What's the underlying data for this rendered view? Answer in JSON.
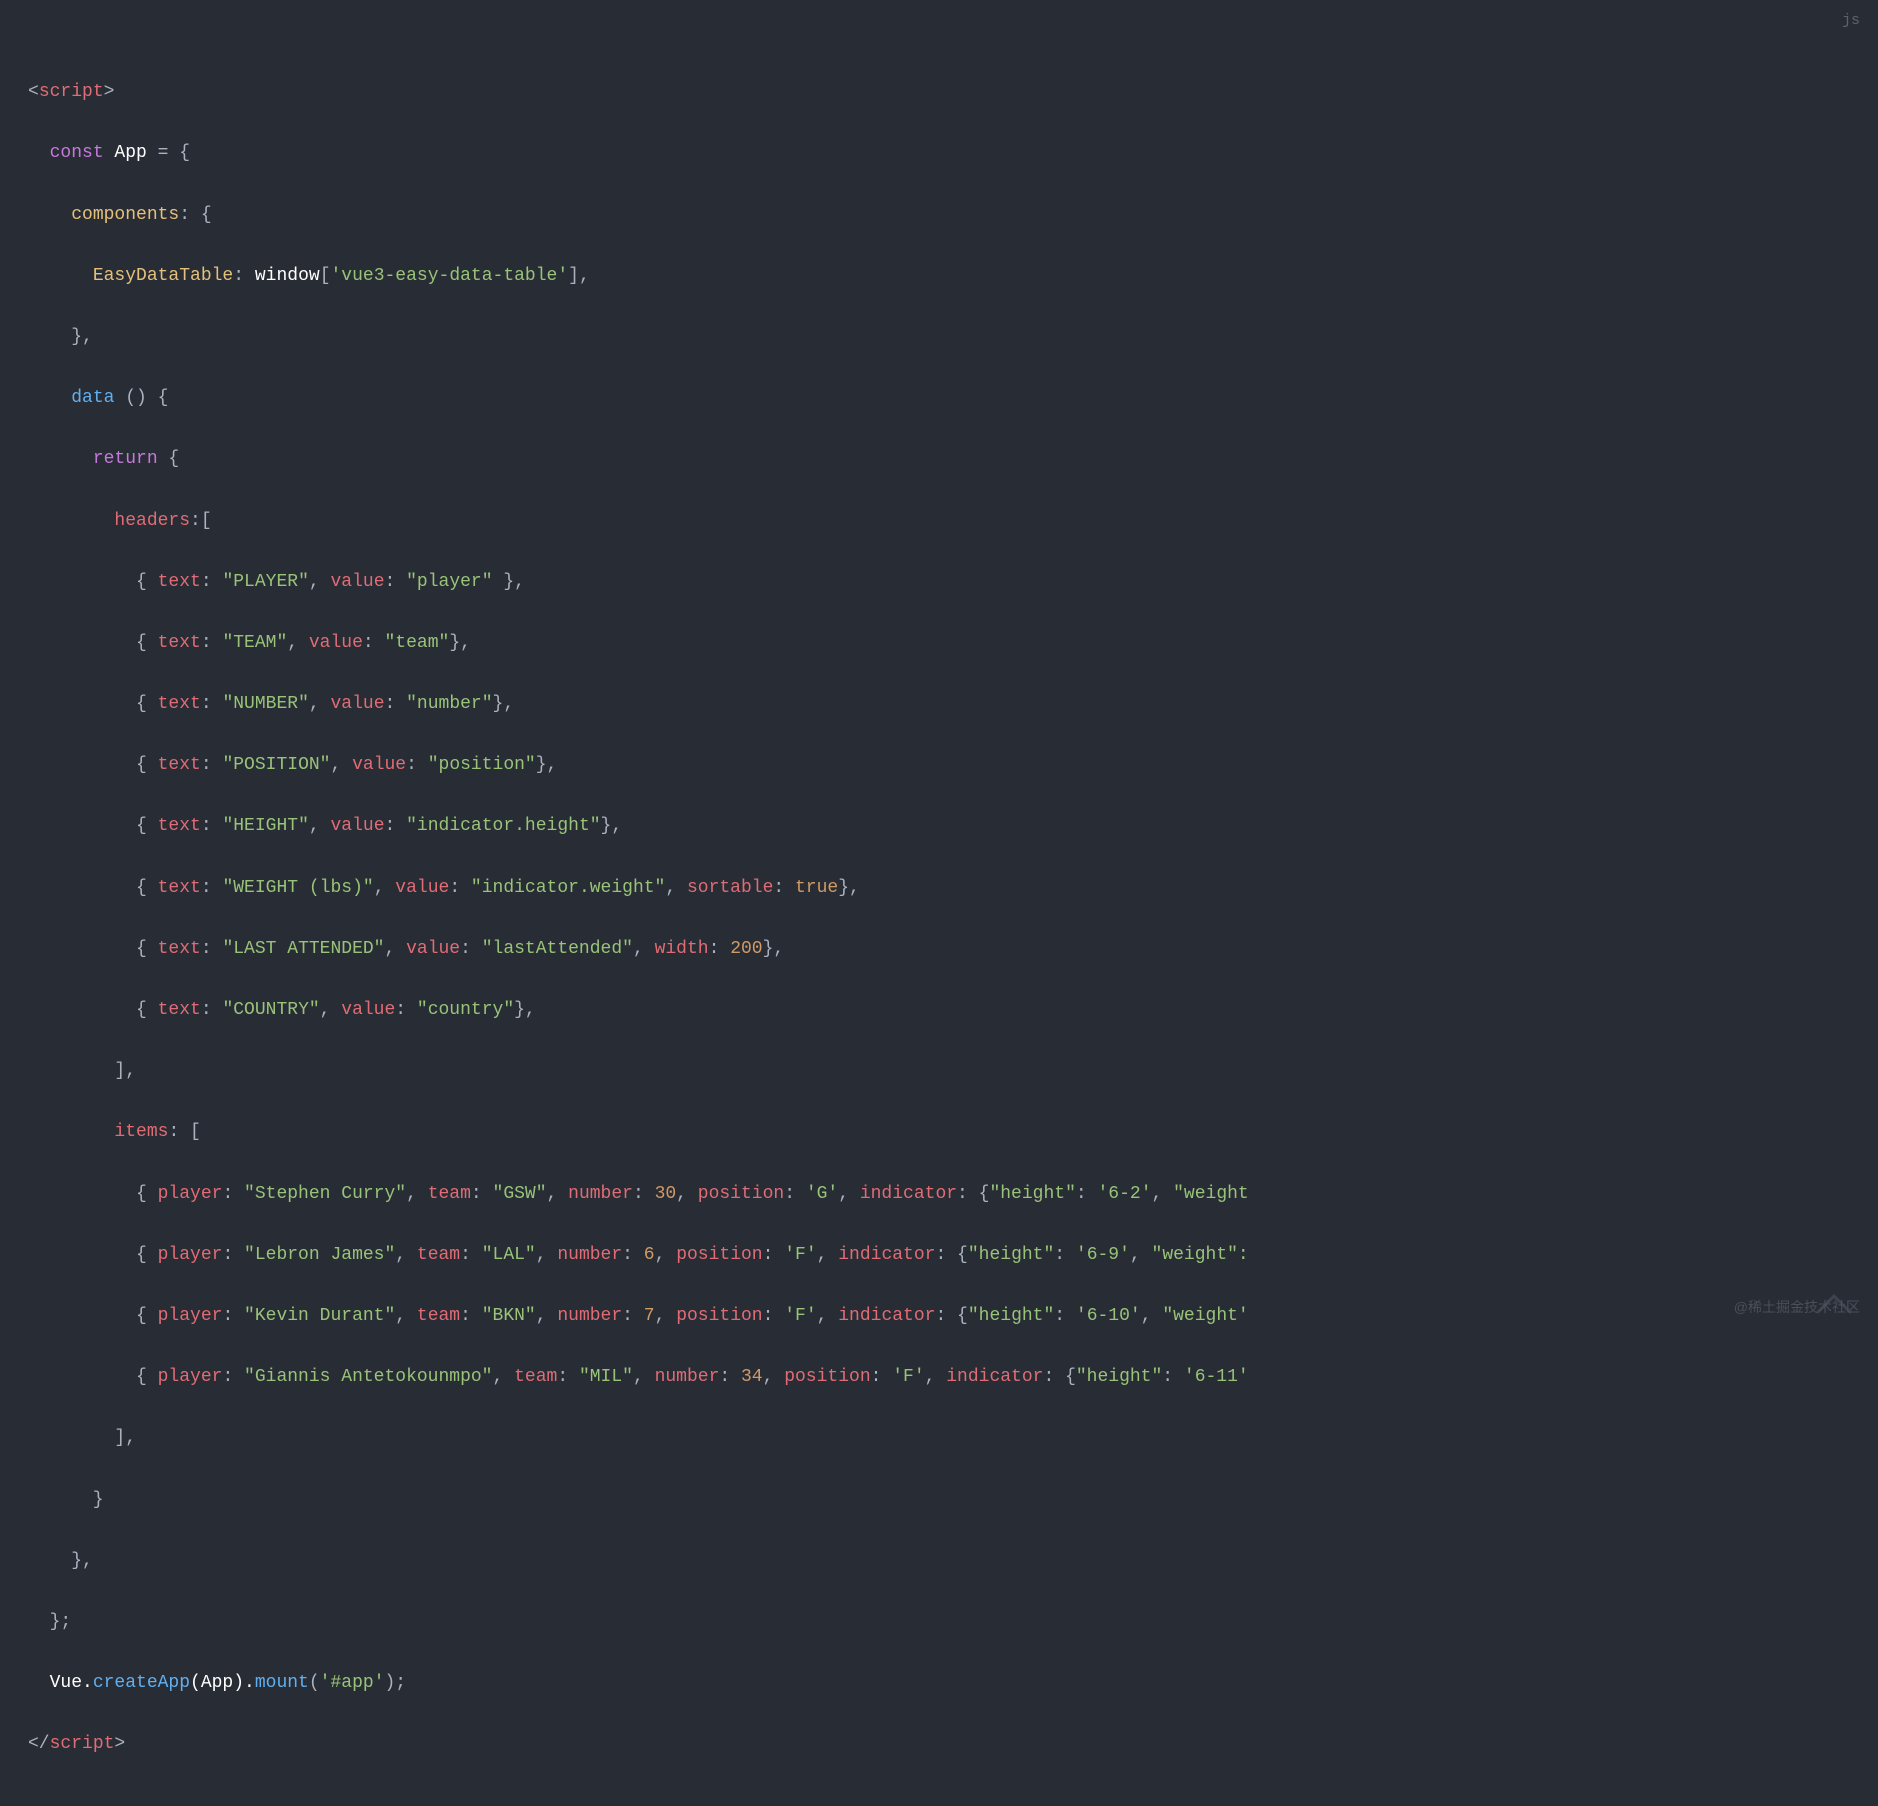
{
  "lang_label": "js",
  "watermark": "@稀土掘金技术社区",
  "code": {
    "l1": {
      "a": "<",
      "b": "script",
      "c": ">"
    },
    "l2": {
      "a": "  ",
      "b": "const",
      "c": " App ",
      "d": "=",
      "e": " {"
    },
    "l3": {
      "a": "    ",
      "b": "components",
      "c": ":",
      "d": " {"
    },
    "l4": {
      "a": "      ",
      "b": "EasyDataTable",
      "c": ":",
      "d": " window",
      "e": "[",
      "f": "'vue3-easy-data-table'",
      "g": "],"
    },
    "l5": {
      "a": "    },"
    },
    "l6": {
      "a": "    ",
      "b": "data",
      "c": " () {"
    },
    "l7": {
      "a": "      ",
      "b": "return",
      "c": " {"
    },
    "l8": {
      "a": "        ",
      "b": "headers",
      "c": ":["
    },
    "l9": {
      "a": "          { ",
      "b": "text",
      "c": ": ",
      "d": "\"PLAYER\"",
      "e": ", ",
      "f": "value",
      "g": ": ",
      "h": "\"player\"",
      "i": " },"
    },
    "l10": {
      "a": "          { ",
      "b": "text",
      "c": ": ",
      "d": "\"TEAM\"",
      "e": ", ",
      "f": "value",
      "g": ": ",
      "h": "\"team\"",
      "i": "},"
    },
    "l11": {
      "a": "          { ",
      "b": "text",
      "c": ": ",
      "d": "\"NUMBER\"",
      "e": ", ",
      "f": "value",
      "g": ": ",
      "h": "\"number\"",
      "i": "},"
    },
    "l12": {
      "a": "          { ",
      "b": "text",
      "c": ": ",
      "d": "\"POSITION\"",
      "e": ", ",
      "f": "value",
      "g": ": ",
      "h": "\"position\"",
      "i": "},"
    },
    "l13": {
      "a": "          { ",
      "b": "text",
      "c": ": ",
      "d": "\"HEIGHT\"",
      "e": ", ",
      "f": "value",
      "g": ": ",
      "h": "\"indicator.height\"",
      "i": "},"
    },
    "l14": {
      "a": "          { ",
      "b": "text",
      "c": ": ",
      "d": "\"WEIGHT (lbs)\"",
      "e": ", ",
      "f": "value",
      "g": ": ",
      "h": "\"indicator.weight\"",
      "i": ", ",
      "j": "sortable",
      "k": ": ",
      "l": "true",
      "m": "},"
    },
    "l15": {
      "a": "          { ",
      "b": "text",
      "c": ": ",
      "d": "\"LAST ATTENDED\"",
      "e": ", ",
      "f": "value",
      "g": ": ",
      "h": "\"lastAttended\"",
      "i": ", ",
      "j": "width",
      "k": ": ",
      "l": "200",
      "m": "},"
    },
    "l16": {
      "a": "          { ",
      "b": "text",
      "c": ": ",
      "d": "\"COUNTRY\"",
      "e": ", ",
      "f": "value",
      "g": ": ",
      "h": "\"country\"",
      "i": "},"
    },
    "l17": {
      "a": "        ],"
    },
    "l18": {
      "a": "        ",
      "b": "items",
      "c": ": ["
    },
    "l19": {
      "a": "          { ",
      "b": "player",
      "c": ": ",
      "d": "\"Stephen Curry\"",
      "e": ", ",
      "f": "team",
      "g": ": ",
      "h": "\"GSW\"",
      "i": ", ",
      "j": "number",
      "k": ": ",
      "l": "30",
      "m": ", ",
      "n": "position",
      "o": ": ",
      "p": "'G'",
      "q": ", ",
      "r": "indicator",
      "s": ": {",
      "t": "\"height\"",
      "u": ": ",
      "v": "'6-2'",
      "w": ", ",
      "x": "\"weight"
    },
    "l20": {
      "a": "          { ",
      "b": "player",
      "c": ": ",
      "d": "\"Lebron James\"",
      "e": ", ",
      "f": "team",
      "g": ": ",
      "h": "\"LAL\"",
      "i": ", ",
      "j": "number",
      "k": ": ",
      "l": "6",
      "m": ", ",
      "n": "position",
      "o": ": ",
      "p": "'F'",
      "q": ", ",
      "r": "indicator",
      "s": ": {",
      "t": "\"height\"",
      "u": ": ",
      "v": "'6-9'",
      "w": ", ",
      "x": "\"weight\":"
    },
    "l21": {
      "a": "          { ",
      "b": "player",
      "c": ": ",
      "d": "\"Kevin Durant\"",
      "e": ", ",
      "f": "team",
      "g": ": ",
      "h": "\"BKN\"",
      "i": ", ",
      "j": "number",
      "k": ": ",
      "l": "7",
      "m": ", ",
      "n": "position",
      "o": ": ",
      "p": "'F'",
      "q": ", ",
      "r": "indicator",
      "s": ": {",
      "t": "\"height\"",
      "u": ": ",
      "v": "'6-10'",
      "w": ", ",
      "x": "\"weight'"
    },
    "l22": {
      "a": "          { ",
      "b": "player",
      "c": ": ",
      "d": "\"Giannis Antetokounmpo\"",
      "e": ", ",
      "f": "team",
      "g": ": ",
      "h": "\"MIL\"",
      "i": ", ",
      "j": "number",
      "k": ": ",
      "l": "34",
      "m": ", ",
      "n": "position",
      "o": ": ",
      "p": "'F'",
      "q": ", ",
      "r": "indicator",
      "s": ": {",
      "t": "\"height\"",
      "u": ": ",
      "v": "'6-11'"
    },
    "l23": {
      "a": "        ],"
    },
    "l24": {
      "a": "      }"
    },
    "l25": {
      "a": "    },"
    },
    "l26": {
      "a": "  };"
    },
    "l27": {
      "a": "  Vue.",
      "b": "createApp",
      "c": "(App).",
      "d": "mount",
      "e": "(",
      "f": "'#app'",
      "g": ");"
    },
    "l28": {
      "a": "</",
      "b": "script",
      "c": ">"
    }
  }
}
